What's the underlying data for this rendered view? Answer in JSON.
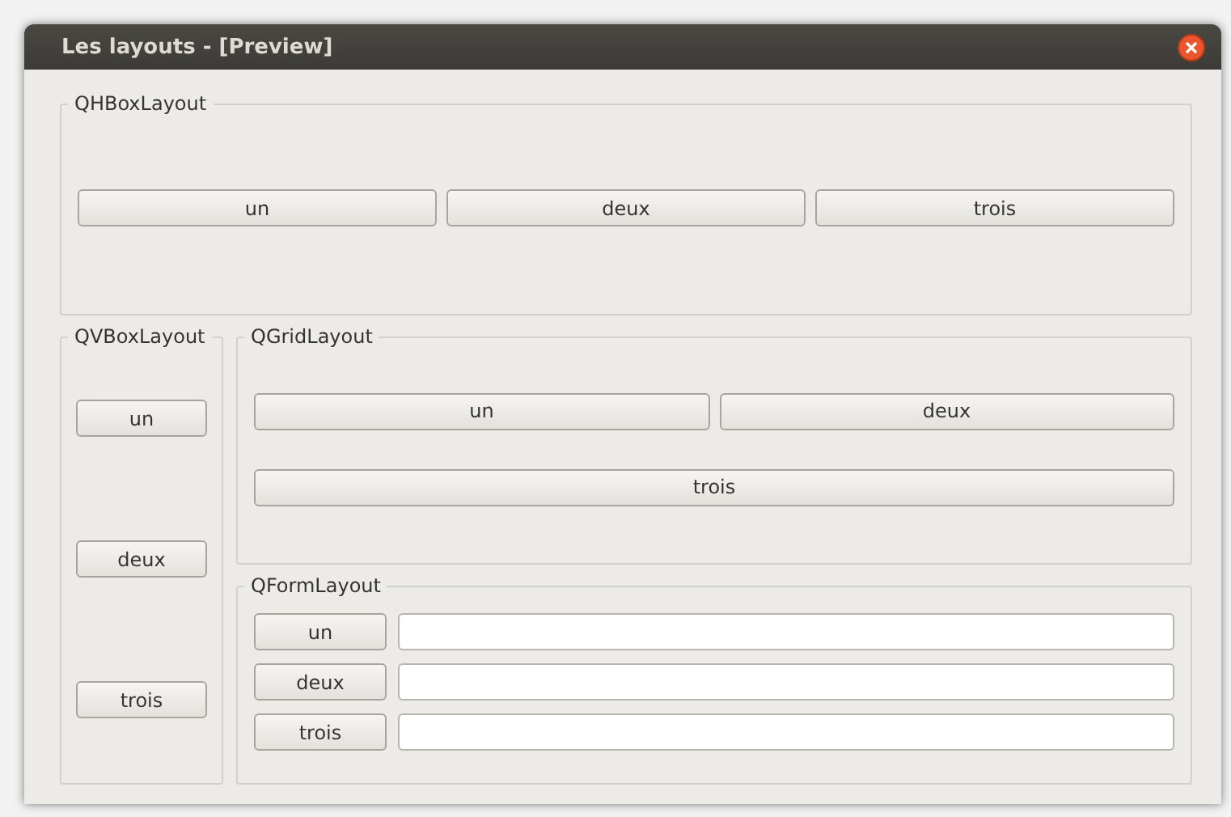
{
  "window": {
    "title": "Les layouts - [Preview]"
  },
  "hbox": {
    "title": "QHBoxLayout",
    "buttons": [
      "un",
      "deux",
      "trois"
    ]
  },
  "vbox": {
    "title": "QVBoxLayout",
    "buttons": [
      "un",
      "deux",
      "trois"
    ]
  },
  "grid": {
    "title": "QGridLayout",
    "rows": [
      [
        "un",
        "deux"
      ],
      [
        "trois"
      ]
    ]
  },
  "form": {
    "title": "QFormLayout",
    "rows": [
      {
        "button": "un"
      },
      {
        "button": "deux"
      },
      {
        "button": "trois"
      }
    ]
  }
}
